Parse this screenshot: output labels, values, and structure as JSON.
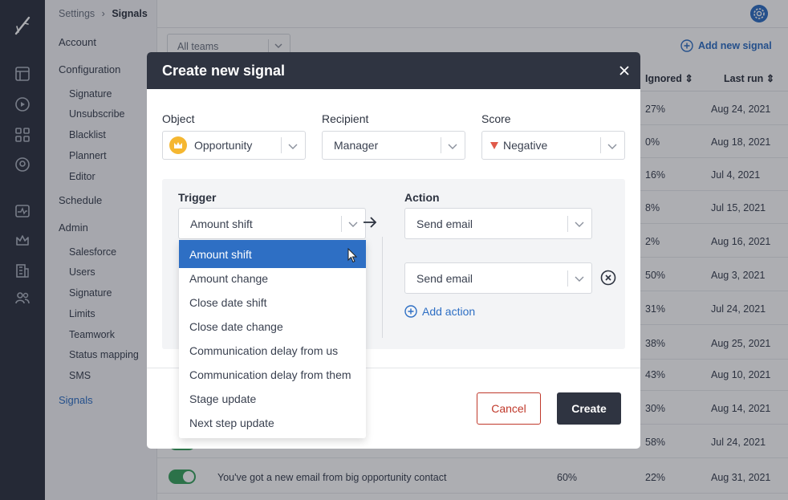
{
  "breadcrumb": {
    "parent": "Settings",
    "separator": "›",
    "current": "Signals"
  },
  "sidebar": {
    "items": [
      {
        "label": "Account",
        "level": 0
      },
      {
        "label": "Configuration",
        "level": 0
      },
      {
        "label": "Signature",
        "level": 1
      },
      {
        "label": "Unsubscribe",
        "level": 1
      },
      {
        "label": "Blacklist",
        "level": 1
      },
      {
        "label": "Plannert",
        "level": 1
      },
      {
        "label": "Editor",
        "level": 1
      },
      {
        "label": "Schedule",
        "level": 0
      },
      {
        "label": "Admin",
        "level": 0
      },
      {
        "label": "Salesforce",
        "level": 1
      },
      {
        "label": "Users",
        "level": 1
      },
      {
        "label": "Signature",
        "level": 1
      },
      {
        "label": "Limits",
        "level": 1
      },
      {
        "label": "Teamwork",
        "level": 1
      },
      {
        "label": "Status mapping",
        "level": 1
      },
      {
        "label": "SMS",
        "level": 1
      },
      {
        "label": "Signals",
        "level": 0,
        "active": true
      }
    ]
  },
  "page": {
    "team_filter": "All teams",
    "add_signal_label": "Add new signal",
    "columns": {
      "ignored": "Ignored",
      "last_run": "Last run"
    },
    "rows": [
      {
        "ignored": "27%",
        "last_run": "Aug 24, 2021"
      },
      {
        "ignored": "0%",
        "last_run": "Aug 18, 2021"
      },
      {
        "ignored": "16%",
        "last_run": "Jul 4, 2021"
      },
      {
        "ignored": "8%",
        "last_run": "Jul 15, 2021"
      },
      {
        "ignored": "2%",
        "last_run": "Aug 16, 2021"
      },
      {
        "ignored": "50%",
        "last_run": "Aug 3, 2021"
      },
      {
        "ignored": "31%",
        "last_run": "Jul 24, 2021"
      },
      {
        "ignored": "38%",
        "last_run": "Aug 25, 2021"
      },
      {
        "ignored": "43%",
        "last_run": "Aug 10, 2021"
      },
      {
        "ignored": "30%",
        "last_run": "Aug 14, 2021"
      },
      {
        "ignored": "58%",
        "last_run": "Jul 24, 2021"
      }
    ],
    "last_row": {
      "name": "You've got a new email from big opportunity contact",
      "value": "60%",
      "ignored": "22%",
      "last_run": "Aug 31, 2021"
    }
  },
  "modal": {
    "title": "Create new signal",
    "object": {
      "label": "Object",
      "value": "Opportunity"
    },
    "recipient": {
      "label": "Recipient",
      "value": "Manager"
    },
    "score": {
      "label": "Score",
      "value": "Negative"
    },
    "trigger": {
      "label": "Trigger",
      "value": "Amount shift"
    },
    "action": {
      "label": "Action",
      "values": [
        "Send email",
        "Send email"
      ]
    },
    "add_action_label": "Add action",
    "cancel_label": "Cancel",
    "create_label": "Create"
  },
  "trigger_dropdown": {
    "options": [
      "Amount shift",
      "Amount change",
      "Close date shift",
      "Close date change",
      "Communication delay from us",
      "Communication delay from them",
      "Stage update",
      "Next step update"
    ],
    "selected_index": 0
  },
  "colors": {
    "accent": "#2e6fc4",
    "dark": "#2f3441",
    "danger": "#c0392b",
    "toggle_on": "#3aa35e",
    "negative_marker": "#e05a4a",
    "object_icon": "#f5b731"
  }
}
